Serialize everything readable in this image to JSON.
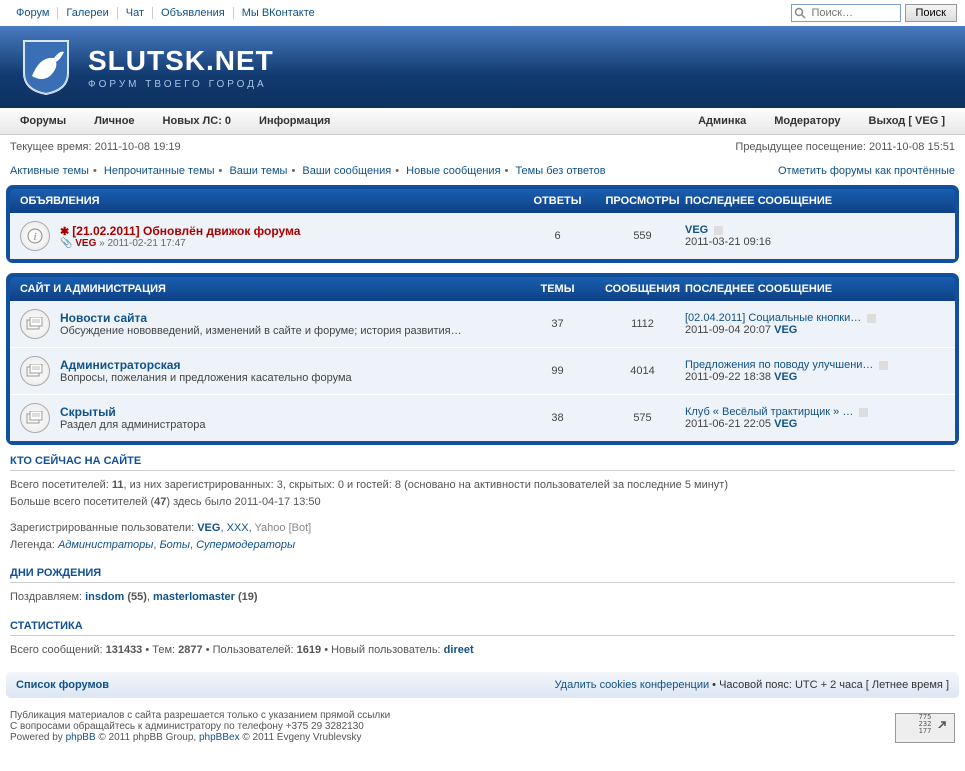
{
  "topnav": [
    "Форум",
    "Галереи",
    "Чат",
    "Объявления",
    "Мы ВКонтакте"
  ],
  "search": {
    "placeholder": "Поиск…",
    "button": "Поиск"
  },
  "site": {
    "title": "SLUTSK.NET",
    "sub": "ФОРУМ ТВОЕГО ГОРОДА"
  },
  "navbar_left": [
    "Форумы",
    "Личное",
    "Новых ЛС: 0",
    "Информация"
  ],
  "navbar_right": [
    "Админка",
    "Модератору",
    "Выход [ VEG ]"
  ],
  "time": {
    "current": "Текущее время: 2011-10-08 19:19",
    "last": "Предыдущее посещение: 2011-10-08 15:51"
  },
  "quicklinks": [
    "Активные темы",
    "Непрочитанные темы",
    "Ваши темы",
    "Ваши сообщения",
    "Новые сообщения",
    "Темы без ответов"
  ],
  "mark_read": "Отметить форумы как прочтённые",
  "cat_announce": {
    "title": "ОБЪЯВЛЕНИЯ",
    "cols": [
      "ОТВЕТЫ",
      "ПРОСМОТРЫ",
      "ПОСЛЕДНЕЕ СООБЩЕНИЕ"
    ],
    "topic": {
      "title": "[21.02.2011] Обновлён движок форума",
      "by": "VEG",
      "date": "» 2011-02-21 17:47",
      "replies": "6",
      "views": "559",
      "last_user": "VEG",
      "last_date": "2011-03-21 09:16"
    }
  },
  "cat_site": {
    "title": "САЙТ И АДМИНИСТРАЦИЯ",
    "cols": [
      "ТЕМЫ",
      "СООБЩЕНИЯ",
      "ПОСЛЕДНЕЕ СООБЩЕНИЕ"
    ],
    "forums": [
      {
        "name": "Новости сайта",
        "desc": "Обсуждение нововведений, изменений в сайте и форуме; история развития…",
        "topics": "37",
        "posts": "1112",
        "last_title": "[02.04.2011] Социальные кнопки…",
        "last_date": "2011-09-04 20:07",
        "last_user": "VEG"
      },
      {
        "name": "Администраторская",
        "desc": "Вопросы, пожелания и предложения касательно форума",
        "topics": "99",
        "posts": "4014",
        "last_title": "Предложения по поводу улучшени…",
        "last_date": "2011-09-22 18:38",
        "last_user": "VEG"
      },
      {
        "name": "Скрытый",
        "desc": "Раздел для администратора",
        "topics": "38",
        "posts": "575",
        "last_title": "Клуб « Весёлый трактирщик » …",
        "last_date": "2011-06-21 22:05",
        "last_user": "VEG"
      }
    ]
  },
  "online": {
    "title": "КТО СЕЙЧАС НА САЙТЕ",
    "line1_a": "Всего посетителей: ",
    "total": "11",
    "line1_b": ", из них зарегистрированных: 3, скрытых: 0 и гостей: 8 (основано на активности пользователей за последние 5 минут)",
    "line2_a": "Больше всего посетителей (",
    "record": "47",
    "line2_b": ") здесь было 2011-04-17 13:50",
    "reg_label": "Зарегистрированные пользователи: ",
    "user1": "VEG",
    "user2": "XXX",
    "user3": "Yahoo [Bot]",
    "legend_label": "Легенда: ",
    "admins": "Администраторы",
    "bots": "Боты",
    "mods": "Супермодераторы"
  },
  "bday": {
    "title": "ДНИ РОЖДЕНИЯ",
    "label": "Поздравляем: ",
    "u1": "insdom",
    "a1": "(55)",
    "u2": "masterlomaster",
    "a2": "(19)"
  },
  "stats": {
    "title": "СТАТИСТИКА",
    "posts_l": "Всего сообщений: ",
    "posts": "131433",
    "topics_l": " • Тем: ",
    "topics": "2877",
    "users_l": " • Пользователей: ",
    "users": "1619",
    "new_l": " • Новый пользователь: ",
    "new_user": "direet"
  },
  "bottom": {
    "index": "Список форумов",
    "cookies": "Удалить cookies конференции",
    "tz": " • Часовой пояс: UTC + 2 часа [ Летнее время ]"
  },
  "footer": {
    "l1": "Публикация материалов с сайта разрешается только с указанием прямой ссылки",
    "l2": "С вопросами обращайтесь к администратору по телефону +375 29 3282130",
    "l3a": "Powered by ",
    "phpbb": "phpBB",
    "l3b": " © 2011 phpBB Group, ",
    "phpbbex": "phpBBex",
    "l3c": " © 2011 Evgeny Vrublevsky",
    "counter": [
      "775",
      "232",
      "177"
    ]
  }
}
